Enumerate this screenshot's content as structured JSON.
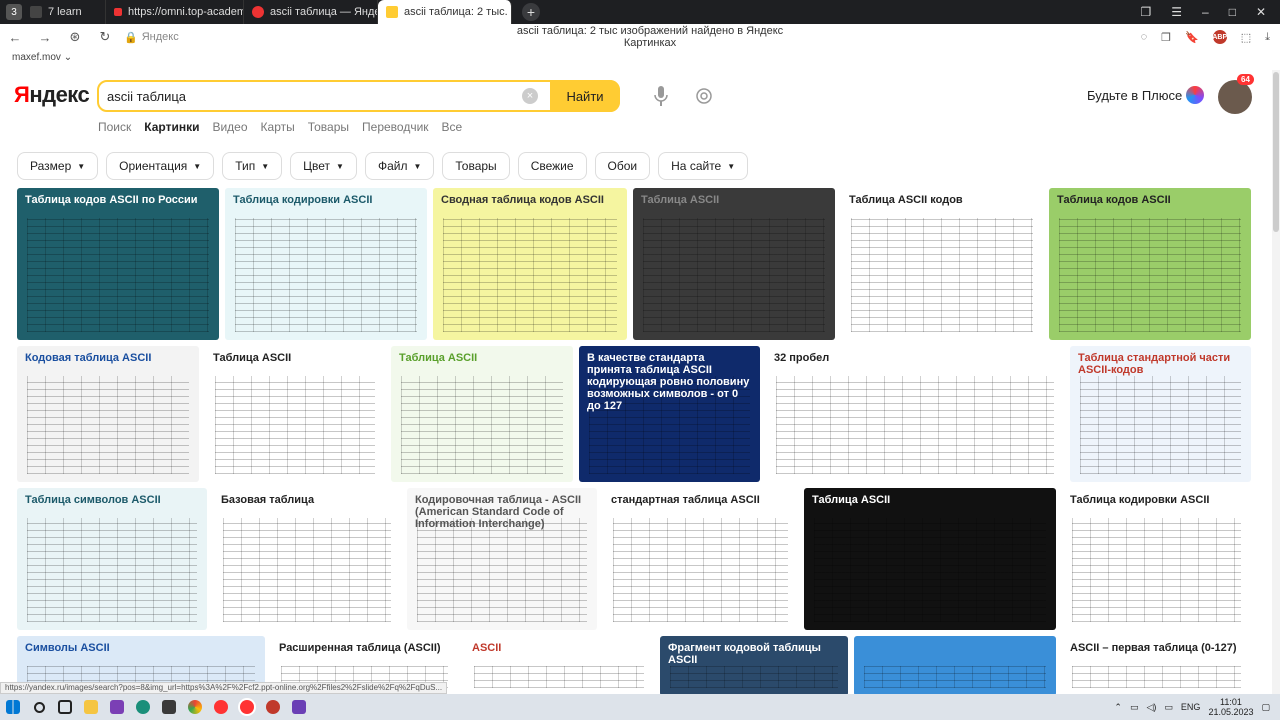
{
  "browser": {
    "tab_count": "3",
    "tabs": [
      {
        "title": "7  learn",
        "color": "#444"
      },
      {
        "title": "https://omni.top-academy.",
        "color": "#e33"
      },
      {
        "title": "ascii таблица — Яндекс:",
        "color": "#e33"
      },
      {
        "title": "ascii таблица: 2 тыс. изо",
        "color": "#fc3"
      }
    ],
    "new_tab": "+",
    "domain": "Яндекс",
    "page_title": "ascii таблица: 2 тыс изображений найдено в Яндекс Картинках",
    "abp": "ABP"
  },
  "user": {
    "login": "maxef.mov"
  },
  "header": {
    "logo_first": "Я",
    "logo_rest": "ндекс",
    "search_value": "ascii таблица",
    "find_label": "Найти",
    "plus_label": "Будьте в Плюсе",
    "badge": "64"
  },
  "services": [
    "Поиск",
    "Картинки",
    "Видео",
    "Карты",
    "Товары",
    "Переводчик",
    "Все"
  ],
  "filters": [
    {
      "label": "Размер",
      "dropdown": true
    },
    {
      "label": "Ориентация",
      "dropdown": true
    },
    {
      "label": "Тип",
      "dropdown": true
    },
    {
      "label": "Цвет",
      "dropdown": true
    },
    {
      "label": "Файл",
      "dropdown": true
    },
    {
      "label": "Товары",
      "dropdown": false
    },
    {
      "label": "Свежие",
      "dropdown": false
    },
    {
      "label": "Обои",
      "dropdown": false
    },
    {
      "label": "На сайте",
      "dropdown": true
    }
  ],
  "images": [
    {
      "label": "Таблица кодов ASCII по России",
      "bg": "#1f5f6b",
      "fg": "#ffffff"
    },
    {
      "label": "Таблица кодировки ASCII",
      "bg": "#e8f6f8",
      "fg": "#1c5a6a"
    },
    {
      "label": "Сводная таблица кодов ASCII",
      "bg": "#f5f5a0",
      "fg": "#333333"
    },
    {
      "label": "Таблица ASCII",
      "bg": "#3a3a3a",
      "fg": "#888888"
    },
    {
      "label": "Таблица ASCII кодов",
      "bg": "#ffffff",
      "fg": "#222222"
    },
    {
      "label": "Таблица кодов ASCII",
      "bg": "#9acd69",
      "fg": "#222222"
    },
    {
      "label": "Кодовая таблица ASCII",
      "bg": "#f3f3f3",
      "fg": "#1a4fa0"
    },
    {
      "label": "Таблица ASCII",
      "bg": "#ffffff",
      "fg": "#222222"
    },
    {
      "label": "Таблица ASCII",
      "bg": "#f2f9ec",
      "fg": "#5aa02c"
    },
    {
      "label": "В качестве стандарта принята таблица ASCII кодирующая ровно половину возможных символов - от 0 до 127",
      "bg": "#0f2a6b",
      "fg": "#ffffff"
    },
    {
      "label": "32 пробел",
      "bg": "#ffffff",
      "fg": "#222222"
    },
    {
      "label": "Таблица стандартной части ASCII-кодов",
      "bg": "#eef4fb",
      "fg": "#c0392b"
    },
    {
      "label": "Таблица символов ASCII",
      "bg": "#e9f4f6",
      "fg": "#1c5a6a"
    },
    {
      "label": "Базовая таблица",
      "bg": "#ffffff",
      "fg": "#222222"
    },
    {
      "label": "Кодировочная таблица - ASCII (American Standard Code of Information Interchange)",
      "bg": "#f7f7f7",
      "fg": "#555555"
    },
    {
      "label": "стандартная таблица ASCII",
      "bg": "#ffffff",
      "fg": "#222222"
    },
    {
      "label": "Таблица ASCII",
      "bg": "#111111",
      "fg": "#ffffff"
    },
    {
      "label": "Таблица кодировки ASCII",
      "bg": "#ffffff",
      "fg": "#222222"
    },
    {
      "label": "Символы ASCII",
      "bg": "#dbe9f7",
      "fg": "#1a4fa0"
    },
    {
      "label": "Расширенная таблица (ASCII)",
      "bg": "#ffffff",
      "fg": "#222222"
    },
    {
      "label": "ASCII",
      "bg": "#ffffff",
      "fg": "#c0392b"
    },
    {
      "label": "Фрагмент кодовой таблицы ASCII",
      "bg": "#2b4a6b",
      "fg": "#ffffff"
    },
    {
      "label": "",
      "bg": "#3a8fd8",
      "fg": "#ffffff"
    },
    {
      "label": "ASCII – первая таблица (0-127)",
      "bg": "#ffffff",
      "fg": "#222222"
    }
  ],
  "status_url": "https://yandex.ru/images/search?pos=8&img_url=https%3A%2F%2Fcf2.ppt-online.org%2Ffiles2%2Fslide%2Fq%2FqDuS...",
  "taskbar": {
    "lang": "ENG",
    "time": "11:01",
    "date": "21.05.2023"
  }
}
